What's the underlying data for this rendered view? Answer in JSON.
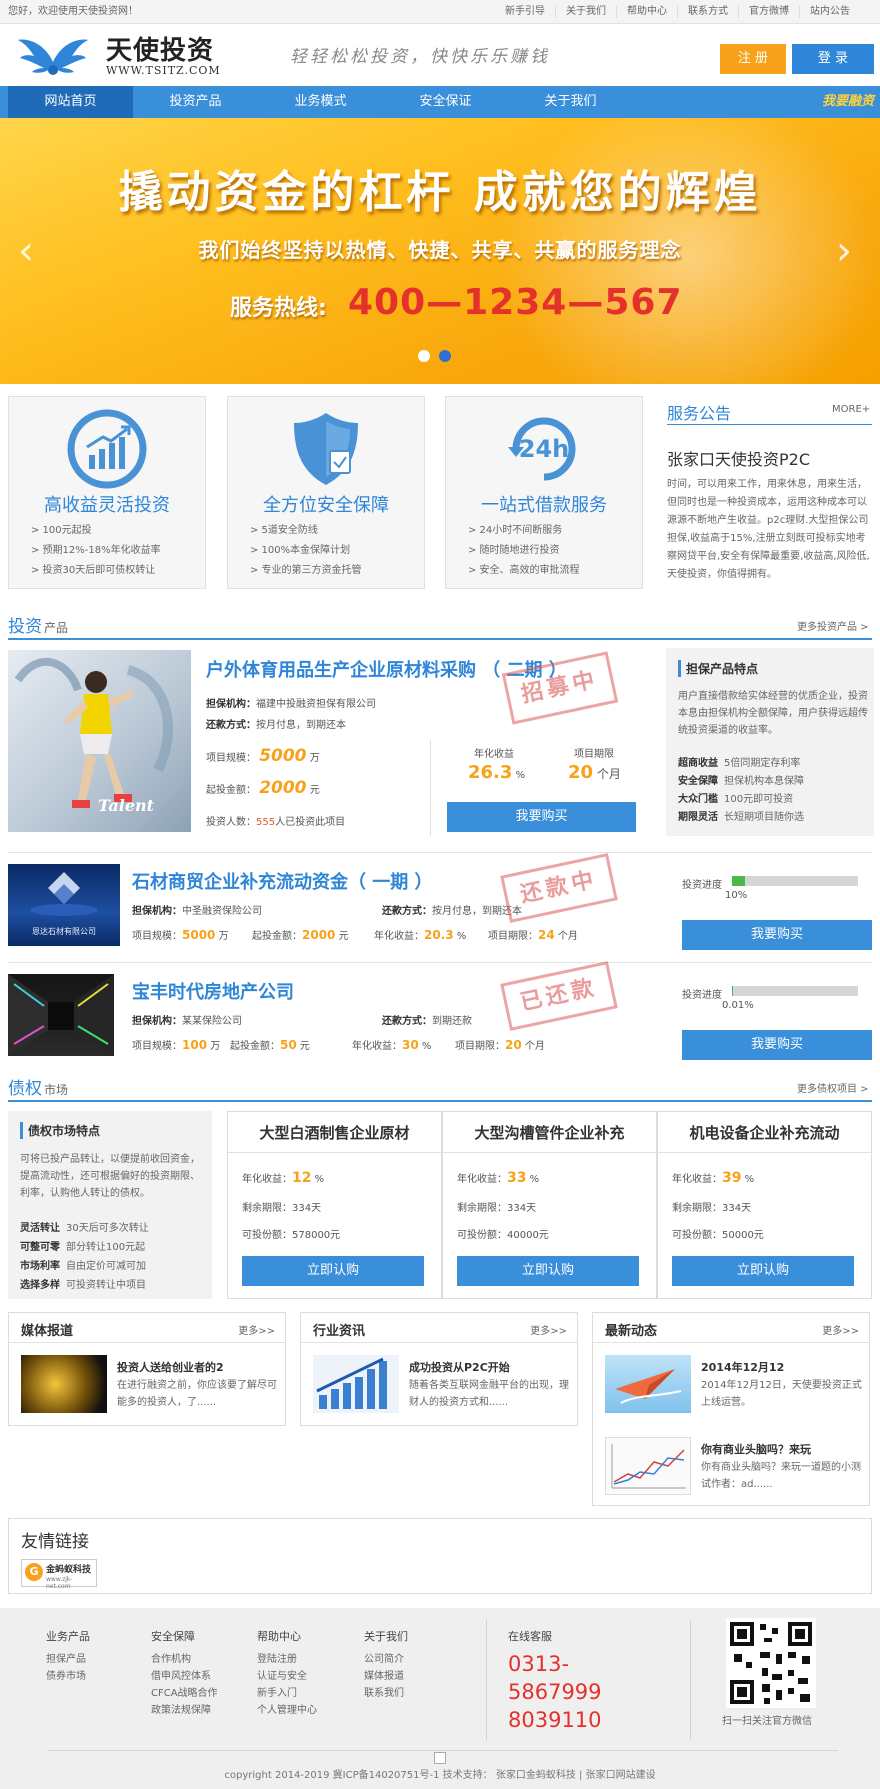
{
  "topbar": {
    "welcome": "您好，欢迎使用天使投资网！",
    "links": [
      "新手引导",
      "关于我们",
      "帮助中心",
      "联系方式",
      "官方微博",
      "站内公告"
    ]
  },
  "header": {
    "logo_cn": "天使投资",
    "logo_en": "WWW.TSITZ.COM",
    "slogan": "轻轻松松投资，快快乐乐赚钱",
    "register": "注 册",
    "login": "登 录"
  },
  "nav": {
    "items": [
      "网站首页",
      "投资产品",
      "业务模式",
      "安全保证",
      "关于我们"
    ],
    "financing": "我要融资"
  },
  "banner": {
    "headline": "撬动资金的杠杆  成就您的辉煌",
    "subline": "我们始终坚持以热情、快捷、共享、共赢的服务理念",
    "hotline_label": "服务热线:",
    "hotline": "400—1234—567",
    "prev": "‹",
    "next": "›"
  },
  "features": [
    {
      "title": "高收益灵活投资",
      "items": [
        "> 100元起投",
        "> 预期12%-18%年化收益率",
        "> 投资30天后即可债权转让"
      ]
    },
    {
      "title": "全方位安全保障",
      "items": [
        "> 5道安全防线",
        "> 100%本金保障计划",
        "> 专业的第三方资金托管"
      ]
    },
    {
      "title": "一站式借款服务",
      "items": [
        "> 24小时不间断服务",
        "> 随时随地进行投资",
        "> 安全、高效的审批流程"
      ],
      "badge": "24h"
    }
  ],
  "notice": {
    "title": "服务公告",
    "more": "MORE+",
    "headline": "张家口天使投资P2C",
    "body": "时间，可以用来工作，用来休息，用来生活，但同时也是一种投资成本，运用这种成本可以源源不断地产生收益。p2c理财.大型担保公司担保,收益高于15%,注册立刻既可投标实地考察网贷平台,安全有保障最重要,收益高,风险低,天使投资，你值得拥有。"
  },
  "invest": {
    "title": "投资",
    "subtitle": "产品",
    "more": "更多投资产品 >",
    "featured": {
      "name": "户外体育用品生产企业原材料采购 （ 二期 ）",
      "guarantor_label": "担保机构：",
      "guarantor": "福建中投融资担保有限公司",
      "repay_label": "还款方式：",
      "repay": "按月付息，到期还本",
      "scale_label": "项目规模：",
      "scale": "5000",
      "scale_unit": "万",
      "min_label": "起投金额：",
      "min": "2000",
      "min_unit": "元",
      "investors_label": "投资人数：",
      "investors": "555",
      "investors_suffix": "人已投资此项目",
      "rate_label": "年化收益",
      "rate": "26.3",
      "rate_unit": "%",
      "term_label": "项目期限",
      "term": "20",
      "term_unit": "个月",
      "button": "我要购买",
      "stamp": "招募中",
      "image_text": "Talent"
    },
    "guarantee": {
      "title": "担保产品特点",
      "body": "用户直接借款给实体经营的优质企业，投资本息由担保机构全额保障，用户获得远超传统投资渠道的收益率。",
      "features": [
        {
          "k": "超商收益",
          "v": "5倍同期定存利率"
        },
        {
          "k": "安全保障",
          "v": "担保机构本息保障"
        },
        {
          "k": "大众门槛",
          "v": "100元即可投资"
        },
        {
          "k": "期限灵活",
          "v": "长短期项目随你选"
        }
      ]
    },
    "list": [
      {
        "name": "石材商贸企业补充流动资金（ 一期 ）",
        "guarantor_label": "担保机构：",
        "guarantor": "中圣融资保险公司",
        "repay_label": "还款方式：",
        "repay": "按月付息，到期还本",
        "scale_label": "项目规模：",
        "scale": "5000",
        "scale_unit": "万",
        "min_label": "起投金额：",
        "min": "2000",
        "min_unit": "元",
        "rate_label": "年化收益：",
        "rate": "20.3",
        "rate_unit": "%",
        "term_label": "项目期限：",
        "term": "24",
        "term_unit": "个月",
        "progress_label": "投资进度",
        "progress_text": "10%",
        "progress": 0.1,
        "stamp": "还款中",
        "button": "我要购买",
        "image_text": "恩达石材有限公司"
      },
      {
        "name": "宝丰时代房地产公司",
        "guarantor_label": "担保机构：",
        "guarantor": "某某保险公司",
        "repay_label": "还款方式：",
        "repay": "到期还款",
        "scale_label": "项目规模：",
        "scale": "100",
        "scale_unit": "万",
        "min_label": "起投金额：",
        "min": "50",
        "min_unit": "元",
        "rate_label": "年化收益：",
        "rate": "30",
        "rate_unit": "%",
        "term_label": "项目期限：",
        "term": "20",
        "term_unit": "个月",
        "progress_label": "投资进度",
        "progress_text": "0.01%",
        "progress": 0.0001,
        "stamp": "已还款",
        "button": "我要购买"
      }
    ]
  },
  "debt": {
    "title": "债权",
    "subtitle": "市场",
    "more": "更多债权项目 >",
    "info": {
      "title": "债权市场特点",
      "body": "可将已投产品转让，以便提前收回资金，提高流动性，还可根据偏好的投资期限、利率，认购他人转让的债权。",
      "features": [
        {
          "k": "灵活转让",
          "v": "30天后可多次转让"
        },
        {
          "k": "可整可零",
          "v": "部分转让100元起"
        },
        {
          "k": "市场利率",
          "v": "自由定价可减可加"
        },
        {
          "k": "选择多样",
          "v": "可投资转让中项目"
        }
      ]
    },
    "cards": [
      {
        "name": "大型白酒制售企业原材",
        "rate_label": "年化收益：",
        "rate": "12",
        "rate_unit": "%",
        "remain_label": "剩余期限：",
        "remain": "334天",
        "avail_label": "可投份额：",
        "avail": "578000元",
        "button": "立即认购"
      },
      {
        "name": "大型沟槽管件企业补充",
        "rate_label": "年化收益：",
        "rate": "33",
        "rate_unit": "%",
        "remain_label": "剩余期限：",
        "remain": "334天",
        "avail_label": "可投份额：",
        "avail": "40000元",
        "button": "立即认购"
      },
      {
        "name": "机电设备企业补充流动",
        "rate_label": "年化收益：",
        "rate": "39",
        "rate_unit": "%",
        "remain_label": "剩余期限：",
        "remain": "334天",
        "avail_label": "可投份额：",
        "avail": "50000元",
        "button": "立即认购"
      }
    ]
  },
  "news": [
    {
      "title": "媒体报道",
      "more": "更多>>",
      "items": [
        {
          "headline": "投资人送给创业者的2",
          "body": "在进行融资之前，你应该要了解尽可能多的投资人，了......"
        }
      ]
    },
    {
      "title": "行业资讯",
      "more": "更多>>",
      "items": [
        {
          "headline": "成功投资从P2C开始",
          "body": "随着各类互联网金融平台的出现，理财人的投资方式和......"
        }
      ]
    },
    {
      "title": "最新动态",
      "more": "更多>>",
      "items": [
        {
          "headline": "2014年12月12",
          "body": "2014年12月12日，天使要投资正式上线运营。"
        },
        {
          "headline": "你有商业头脑吗？来玩",
          "body": "你有商业头脑吗？来玩一道题的小测试作者：ad......"
        }
      ]
    }
  ],
  "friends": {
    "title": "友情链接",
    "logo_text": "金蚂蚁科技",
    "logo_url": "www.zjk-net.com"
  },
  "footer": {
    "cols": [
      {
        "title": "业务产品",
        "items": [
          "担保产品",
          "债券市场"
        ]
      },
      {
        "title": "安全保障",
        "items": [
          "合作机构",
          "借申风控体系",
          "CFCA战略合作",
          "政策法规保障"
        ]
      },
      {
        "title": "帮助中心",
        "items": [
          "登陆注册",
          "认证与安全",
          "新手入门",
          "个人管理中心"
        ]
      },
      {
        "title": "关于我们",
        "items": [
          "公司简介",
          "媒体报道",
          "联系我们"
        ]
      }
    ],
    "service_label": "在线客服",
    "phones": [
      "0313-",
      "5867999",
      "8039110"
    ],
    "qr_caption": "扫一扫关注官方微信",
    "copyright": "copyright 2014-2019 冀ICP备14020751号-1 技术支持： 张家口金蚂蚁科技 | 张家口网站建设"
  },
  "colors": {
    "accent": "#3a8fdb",
    "orange": "#f7a21a",
    "red": "#e4312c"
  }
}
